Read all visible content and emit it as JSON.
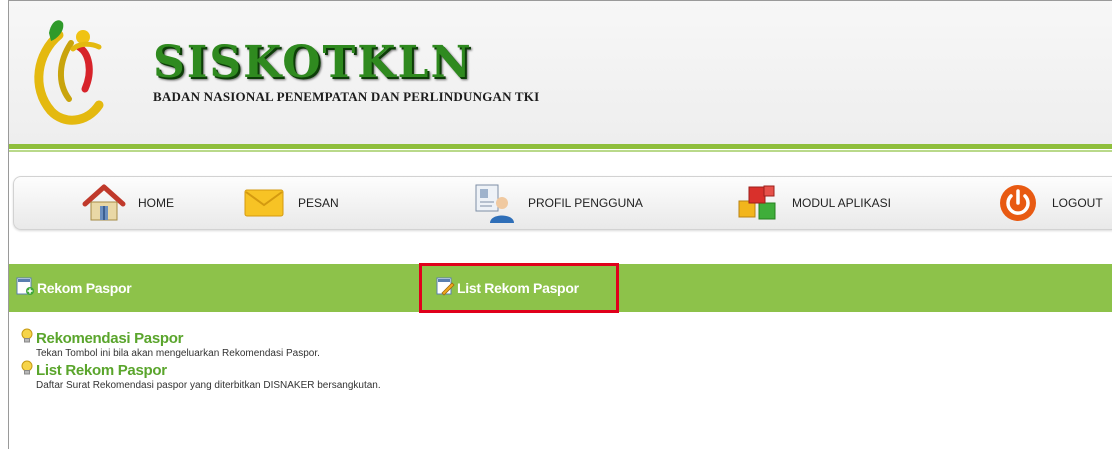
{
  "brand": {
    "title": "SISKOTKLN",
    "subtitle": "BADAN NASIONAL PENEMPATAN DAN PERLINDUNGAN TKI"
  },
  "menu": [
    {
      "label": "HOME",
      "icon": "home-icon"
    },
    {
      "label": "PESAN",
      "icon": "envelope-icon"
    },
    {
      "label": "PROFIL PENGGUNA",
      "icon": "user-profile-icon"
    },
    {
      "label": "MODUL APLIKASI",
      "icon": "modules-icon"
    },
    {
      "label": "LOGOUT",
      "icon": "power-icon"
    }
  ],
  "tabs": [
    {
      "label": "Rekom Paspor",
      "icon": "document-add-icon"
    },
    {
      "label": "List Rekom Paspor",
      "icon": "document-edit-icon",
      "highlighted": true
    }
  ],
  "entries": [
    {
      "title": "Rekomendasi Paspor",
      "description": "Tekan Tombol ini bila akan mengeluarkan Rekomendasi Paspor.",
      "icon": "lightbulb-icon"
    },
    {
      "title": "List Rekom Paspor",
      "description": "Daftar Surat Rekomendasi paspor yang diterbitkan DISNAKER bersangkutan.",
      "icon": "lightbulb-icon"
    }
  ],
  "colors": {
    "accent_green": "#8dc24a",
    "title_green": "#5aa52c",
    "highlight_red": "#e0001b"
  }
}
